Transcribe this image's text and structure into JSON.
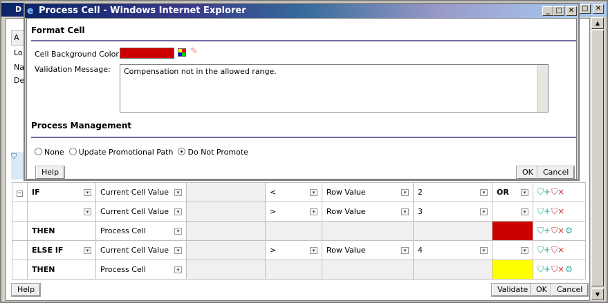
{
  "background_window": {
    "title_prefix": "D",
    "side_labels": [
      "Lo",
      "Na",
      "De"
    ],
    "tab_prefix": "A"
  },
  "popup": {
    "title": "Process Cell - Windows Internet Explorer",
    "format_cell": {
      "heading": "Format Cell",
      "bg_color_label": "Cell Background Color :",
      "bg_color": "#cc0000",
      "validation_label": "Validation Message:",
      "validation_value": "Compensation not in the allowed range."
    },
    "process_management": {
      "heading": "Process Management",
      "options": [
        {
          "label": "None",
          "selected": false
        },
        {
          "label": "Update Promotional Path",
          "selected": false
        },
        {
          "label": "Do Not Promote",
          "selected": true
        }
      ]
    },
    "help_label": "Help",
    "ok_label": "OK",
    "cancel_label": "Cancel"
  },
  "rows": [
    {
      "keyword": "IF",
      "source": "Current Cell Value",
      "op": "<",
      "target": "Row Value",
      "value": "2",
      "logic": "OR",
      "color": null
    },
    {
      "keyword": "",
      "source": "Current Cell Value",
      "op": ">",
      "target": "Row Value",
      "value": "3",
      "logic": "",
      "color": null
    },
    {
      "keyword": "THEN",
      "source": "Process Cell",
      "op": "",
      "target": "",
      "value": "",
      "logic": "",
      "color": "#cc0000"
    },
    {
      "keyword": "ELSE IF",
      "source": "Current Cell Value",
      "op": ">",
      "target": "Row Value",
      "value": "4",
      "logic": "",
      "color": null
    },
    {
      "keyword": "THEN",
      "source": "Process Cell",
      "op": "",
      "target": "",
      "value": "",
      "logic": "",
      "color": "#ffff00"
    }
  ],
  "footer": {
    "help_label": "Help",
    "validate_label": "Validate",
    "ok_label": "OK",
    "cancel_label": "Cancel"
  },
  "icons": {
    "add": "add-condition-icon",
    "delete": "delete-condition-icon",
    "format": "format-cell-icon"
  }
}
